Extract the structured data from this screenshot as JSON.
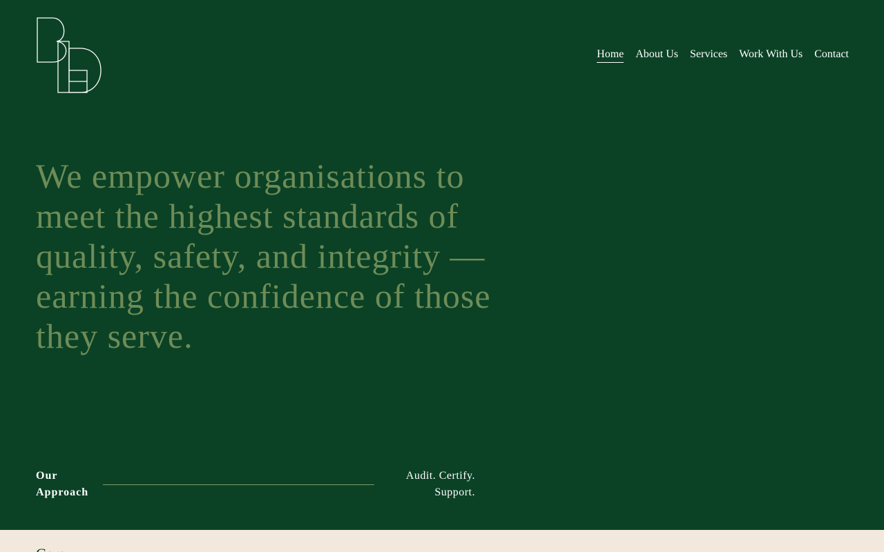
{
  "brand": {
    "logo_text": "BLD",
    "logo_color": "#ffffff"
  },
  "nav": {
    "items": [
      {
        "label": "Home",
        "active": true
      },
      {
        "label": "About Us",
        "active": false
      },
      {
        "label": "Services",
        "active": false
      },
      {
        "label": "Work With Us",
        "active": false
      },
      {
        "label": "Contact",
        "active": false
      }
    ]
  },
  "hero": {
    "headline": "We empower organisations to meet the highest standards of quality, safety, and integrity — earning the confidence of those they serve."
  },
  "approach": {
    "label": "Our Approach",
    "tagline": "Audit. Certify. Support."
  },
  "next_section": {
    "title": "Core"
  },
  "colors": {
    "background": "#0b4225",
    "headline": "#6e8c58",
    "text": "#ffffff",
    "section_bg": "#f2e8dc"
  }
}
